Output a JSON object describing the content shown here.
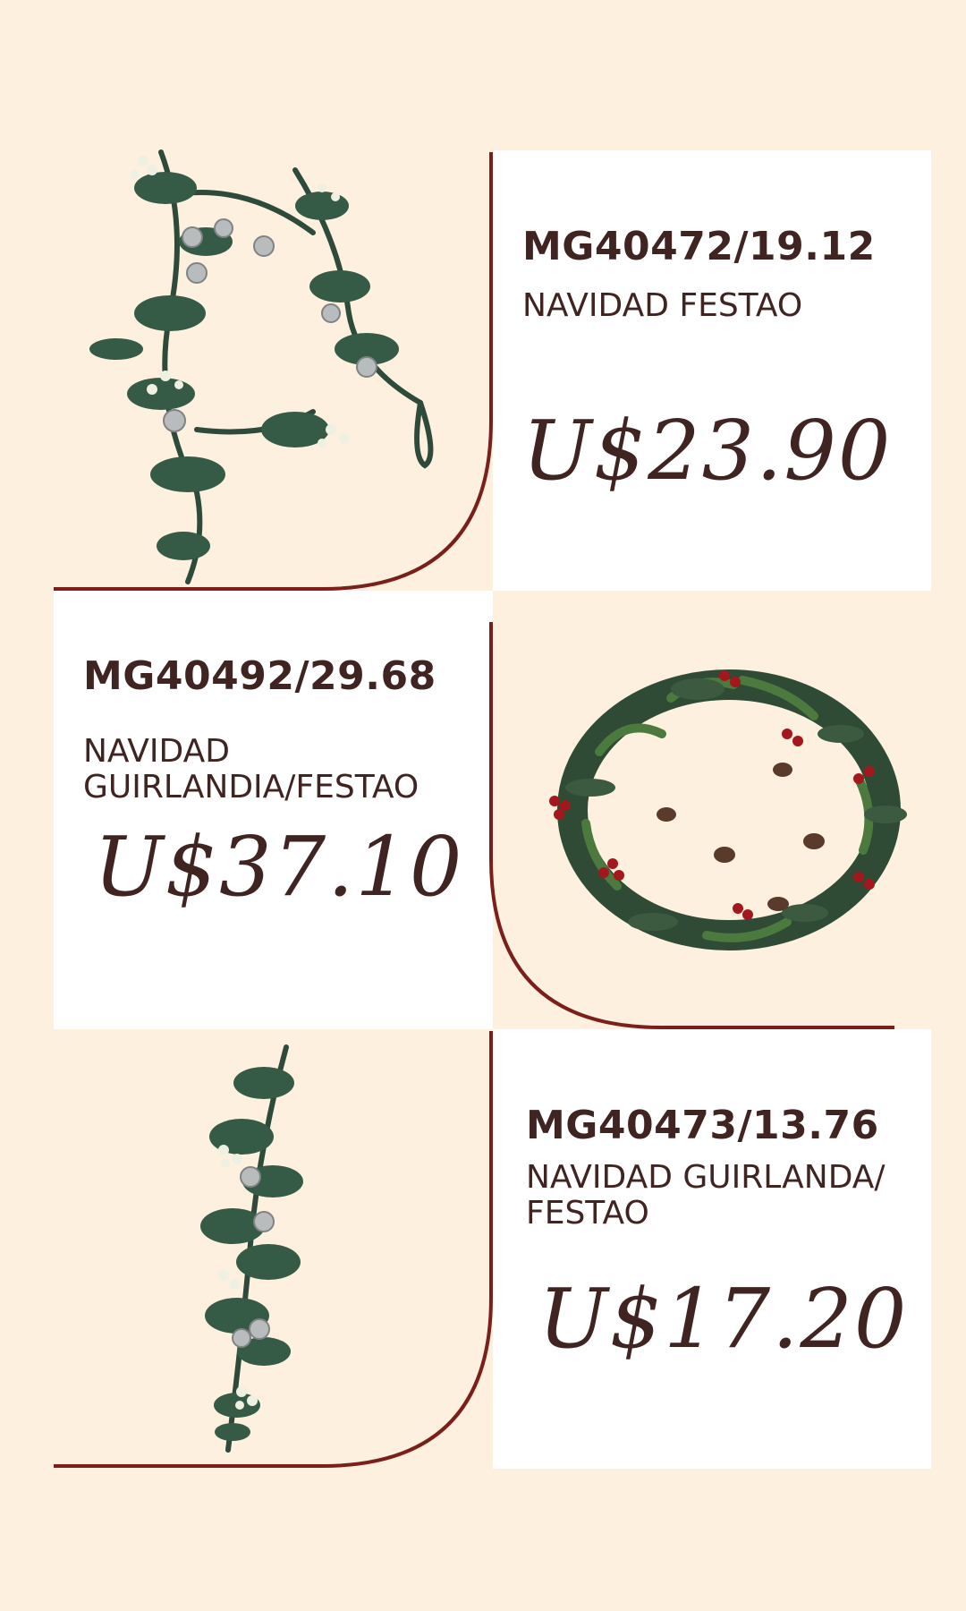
{
  "products": [
    {
      "code": "MG40472/19.12",
      "description": "NAVIDAD FESTAO",
      "price": "U$23.90",
      "image": "garland-with-silver-ornaments"
    },
    {
      "code": "MG40492/29.68",
      "description_line1": "NAVIDAD",
      "description_line2": "GUIRLANDIA/FESTAO",
      "price": "U$37.10",
      "image": "wreath-with-red-berries"
    },
    {
      "code": "MG40473/13.76",
      "description_line1": "NAVIDAD GUIRLANDA/",
      "description_line2": "FESTAO",
      "price": "U$17.20",
      "image": "swag-with-white-berries"
    }
  ],
  "colors": {
    "background": "#fdf0de",
    "panel": "#ffffff",
    "text": "#3f2421",
    "accent_line": "#7a1f1a"
  }
}
